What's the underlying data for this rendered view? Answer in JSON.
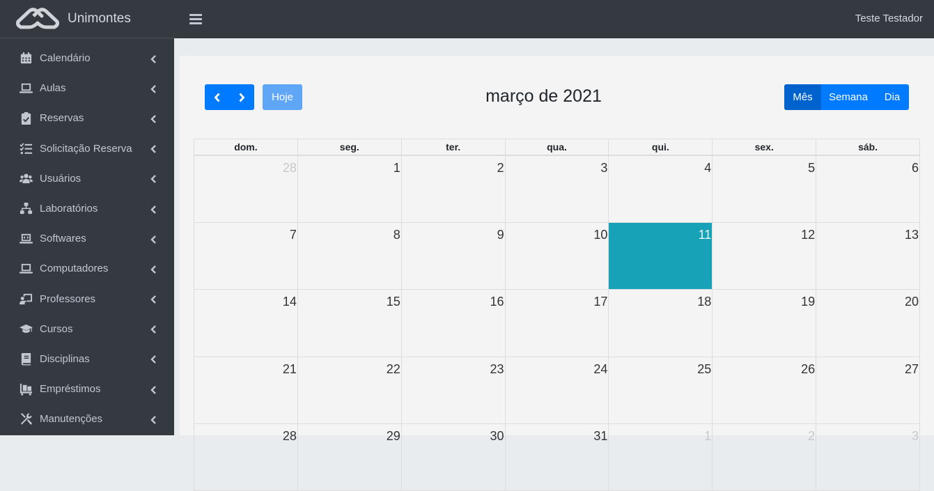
{
  "brand": {
    "name": "Unimontes",
    "logo_icon": "unimontes-logo-icon"
  },
  "sidebar": {
    "items": [
      {
        "label": "Calendário",
        "icon": "calendar-icon"
      },
      {
        "label": "Aulas",
        "icon": "laptop-icon"
      },
      {
        "label": "Reservas",
        "icon": "clipboard-check-icon"
      },
      {
        "label": "Solicitação Reserva",
        "icon": "tasks-icon"
      },
      {
        "label": "Usuários",
        "icon": "users-icon"
      },
      {
        "label": "Laboratórios",
        "icon": "network-icon"
      },
      {
        "label": "Softwares",
        "icon": "laptop-code-icon"
      },
      {
        "label": "Computadores",
        "icon": "laptop-icon"
      },
      {
        "label": "Professores",
        "icon": "chalkboard-teacher-icon"
      },
      {
        "label": "Cursos",
        "icon": "graduation-cap-icon"
      },
      {
        "label": "Disciplinas",
        "icon": "book-icon"
      },
      {
        "label": "Empréstimos",
        "icon": "dolly-icon"
      },
      {
        "label": "Manutenções",
        "icon": "tools-icon"
      }
    ]
  },
  "topbar": {
    "user_name": "Teste Testador"
  },
  "calendar": {
    "title": "março de 2021",
    "today_label": "Hoje",
    "views": [
      {
        "label": "Mês",
        "active": true
      },
      {
        "label": "Semana",
        "active": false
      },
      {
        "label": "Dia",
        "active": false
      }
    ],
    "weekdays": [
      "dom.",
      "seg.",
      "ter.",
      "qua.",
      "qui.",
      "sex.",
      "sáb."
    ],
    "weeks": [
      [
        {
          "day": "28",
          "other": true
        },
        {
          "day": "1"
        },
        {
          "day": "2"
        },
        {
          "day": "3"
        },
        {
          "day": "4"
        },
        {
          "day": "5"
        },
        {
          "day": "6"
        }
      ],
      [
        {
          "day": "7"
        },
        {
          "day": "8"
        },
        {
          "day": "9"
        },
        {
          "day": "10"
        },
        {
          "day": "11",
          "today": true
        },
        {
          "day": "12"
        },
        {
          "day": "13"
        }
      ],
      [
        {
          "day": "14"
        },
        {
          "day": "15"
        },
        {
          "day": "16"
        },
        {
          "day": "17"
        },
        {
          "day": "18"
        },
        {
          "day": "19"
        },
        {
          "day": "20"
        }
      ],
      [
        {
          "day": "21"
        },
        {
          "day": "22"
        },
        {
          "day": "23"
        },
        {
          "day": "24"
        },
        {
          "day": "25"
        },
        {
          "day": "26"
        },
        {
          "day": "27"
        }
      ],
      [
        {
          "day": "28"
        },
        {
          "day": "29"
        },
        {
          "day": "30"
        },
        {
          "day": "31"
        },
        {
          "day": "1",
          "other": true
        },
        {
          "day": "2",
          "other": true
        },
        {
          "day": "3",
          "other": true
        }
      ]
    ],
    "colors": {
      "primary": "#007bff",
      "primary_active": "#0062cc",
      "today_button": "#5fa6f7",
      "today_cell": "#17a2b8"
    }
  }
}
